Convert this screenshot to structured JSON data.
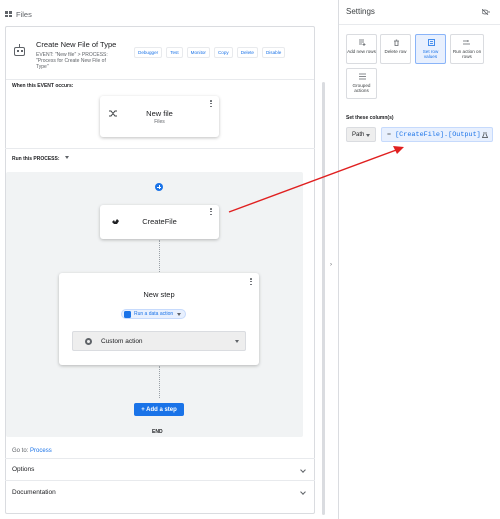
{
  "files_header": {
    "label": "Files"
  },
  "automation": {
    "title": "Create New File of Type",
    "subtitle": "EVENT: \"New file\" > PROCESS: \"Process for Create New File of Type\"",
    "actions": [
      "Debugger",
      "Test",
      "Monitor",
      "Copy",
      "Delete",
      "Disable"
    ]
  },
  "event_section": {
    "label": "When this EVENT occurs:",
    "card_title": "New file",
    "card_sub": "Files"
  },
  "process_section": {
    "label": "Run this PROCESS:",
    "step1_title": "CreateFile",
    "step2_title": "New step",
    "chip_label": "Run a data action",
    "select_label": "Custom action",
    "add_step_label": "+ Add a step",
    "end_label": "END"
  },
  "footer": {
    "goto_prefix": "Go to:",
    "goto_link": "Process",
    "options": "Options",
    "documentation": "Documentation"
  },
  "settings": {
    "title": "Settings",
    "tiles": [
      {
        "label": "Add new rows",
        "icon": "add-rows-icon",
        "selected": false
      },
      {
        "label": "Delete row",
        "icon": "trash-icon",
        "selected": false
      },
      {
        "label": "Set row values",
        "icon": "set-values-icon",
        "selected": true
      },
      {
        "label": "Run action on rows",
        "icon": "run-action-icon",
        "selected": false
      },
      {
        "label": "Grouped actions",
        "icon": "list-icon",
        "selected": false
      }
    ],
    "set_cols_label": "Set these column(s)",
    "column": "Path",
    "expression_prefix": "=",
    "expression": "[CreateFile].[Output]"
  },
  "colors": {
    "accent": "#1a73e8",
    "arrow": "#e02020"
  }
}
